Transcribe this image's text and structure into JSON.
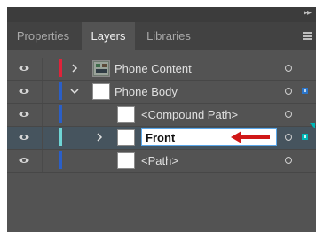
{
  "tabs": [
    {
      "label": "Properties",
      "active": false
    },
    {
      "label": "Layers",
      "active": true
    },
    {
      "label": "Libraries",
      "active": false
    }
  ],
  "layers": [
    {
      "name": "Phone Content",
      "type": "layer",
      "color": "#e0233a",
      "expanded": false
    },
    {
      "name": "Phone Body",
      "type": "layer",
      "color": "#2b5fc7",
      "expanded": true
    },
    {
      "name": "<Compound Path>",
      "type": "path",
      "color": "#2b5fc7"
    },
    {
      "name": "Front",
      "type": "group",
      "color": "#6fd5d5",
      "editing": true
    },
    {
      "name": "<Path>",
      "type": "path",
      "color": "#2b5fc7"
    }
  ],
  "colors": {
    "panel": "#535353",
    "selected_row": "#46545e",
    "annotation_arrow": "#d01818"
  },
  "icons": [
    "eye-icon",
    "chevron-right-icon",
    "chevron-down-icon",
    "target-circle-icon",
    "panel-menu-icon",
    "collapse-icon"
  ]
}
